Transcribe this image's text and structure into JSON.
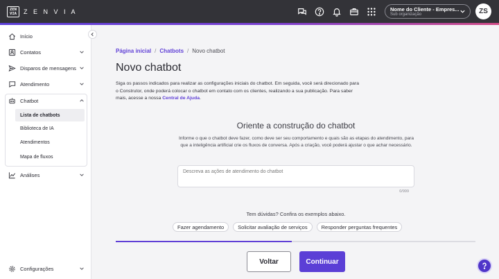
{
  "header": {
    "logo_mark": "ZEN VIA",
    "brand": "Z E N V I A",
    "icons": [
      "chat-icon",
      "help-circle-icon",
      "bell-icon",
      "briefcase-icon",
      "apps-grid-icon"
    ],
    "org_name": "Nome do Cliente - Empres...",
    "org_sub": "Sub organização",
    "avatar_initials": "ZS"
  },
  "sidebar": {
    "items": [
      {
        "label": "Início",
        "icon": "home-icon"
      },
      {
        "label": "Contatos",
        "icon": "contacts-icon"
      },
      {
        "label": "Disparos de mensagens",
        "icon": "send-icon"
      },
      {
        "label": "Atendimento",
        "icon": "chat-bubble-icon"
      },
      {
        "label": "Chatbot",
        "icon": "chatbot-icon"
      },
      {
        "label": "Análises",
        "icon": "chart-line-icon"
      },
      {
        "label": "Configurações",
        "icon": "gear-icon"
      }
    ],
    "chatbot_sub": [
      "Lista de chatbots",
      "Biblioteca de IA",
      "Atendimentos",
      "Mapa de fluxos"
    ]
  },
  "breadcrumb": {
    "home": "Página inicial",
    "sep": "/",
    "chatbots": "Chatbots",
    "current": "Novo chatbot"
  },
  "page": {
    "title": "Novo chatbot",
    "intro": "Siga os passos indicados para realizar as configurações iniciais do chatbot. Em seguida, você será direcionado para o Construtor, onde poderá colocar o chatbot em contato com os clientes, realizando a sua publicação. Para saber mais, acesse a nossa ",
    "help_link": "Central de Ajuda",
    "intro_end": "."
  },
  "builder": {
    "title": "Oriente a construção do chatbot",
    "desc": "Informe o que o chatbot deve fazer, como deve ser seu comportamento e quais são as etapas do atendimento, para que a inteligência artificial crie os fluxos de conversa. Após a criação, você poderá ajustar o que achar necessário.",
    "placeholder": "Descreva as ações de atendimento do chatbot",
    "counter": "0/999",
    "doubts": "Tem dúvidas? Confira os exemplos abaixo.",
    "examples": [
      "Fazer agendamento",
      "Solicitar avaliação de serviços",
      "Responder perguntas frequentes"
    ]
  },
  "progress": 0.49,
  "actions": {
    "back": "Voltar",
    "next": "Continuar"
  },
  "colors": {
    "primary": "#5b3fd6",
    "topbar": "#333338"
  }
}
